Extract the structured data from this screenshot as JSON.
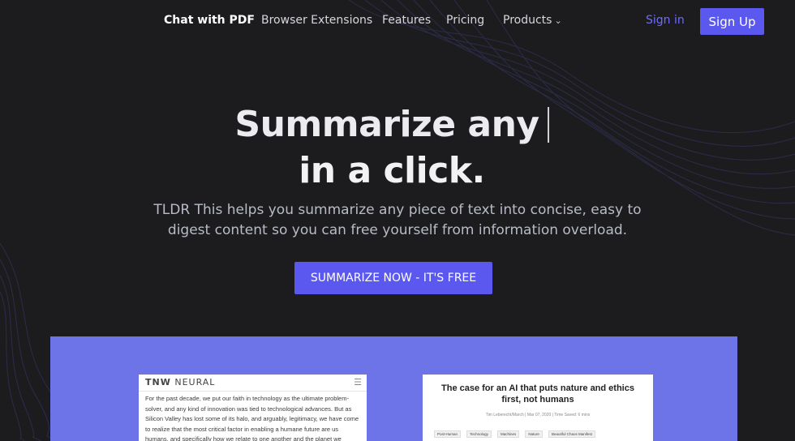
{
  "nav": {
    "brand": "Chat with PDF",
    "links": [
      "Browser Extensions",
      "Features",
      "Pricing",
      "Products"
    ],
    "signin": "Sign in",
    "signup": "Sign Up"
  },
  "hero": {
    "headline_line1": "Summarize any",
    "headline_line2": "in a click.",
    "subtitle": "TLDR This helps you summarize any piece of text into concise, easy to digest content so you can free yourself from information overload.",
    "cta": "SUMMARIZE NOW - IT'S FREE"
  },
  "preview": {
    "left_card": {
      "logo_bold": "TNW",
      "logo_rest": "NEURAL",
      "body": "For the past decade, we put our faith in technology as the ultimate problem-solver, and any kind of innovation was tied to technological advances. But as Silicon Valley has lost some of its halo, and arguably, legitimacy, we have come to realize that the most critical factor in enabling a humane future are us humans, and specifically how we relate to one another and the planet we inhabit. The real"
    },
    "right_card": {
      "title": "The case for an AI that puts nature and ethics first, not humans",
      "meta": "Tim Leberecht/March  |  Mar 07, 2020  |  Time Saved: 6 mins",
      "tags": [
        "Post-Human",
        "Technology",
        "Machines",
        "Nature",
        "Beautiful Chaos Manifest"
      ]
    }
  },
  "colors": {
    "background": "#1c1c1f",
    "accent": "#5b58f0",
    "preview_bg": "#6d74e8"
  }
}
